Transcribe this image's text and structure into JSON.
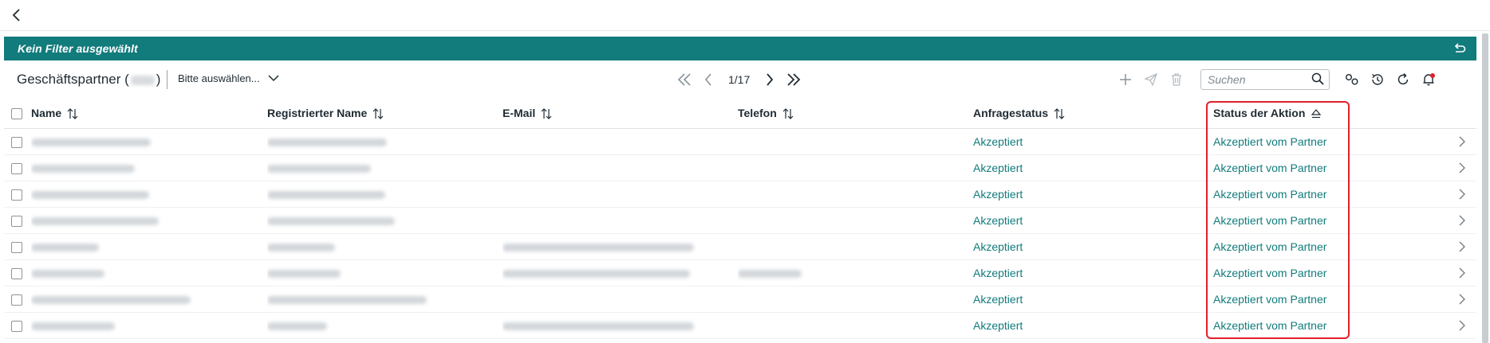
{
  "nav": {
    "back_icon": "chevron-left-icon"
  },
  "filter_bar": {
    "text": "Kein Filter ausgewählt",
    "reset_icon": "undo-icon",
    "color": "#127b7c"
  },
  "toolbar": {
    "title_prefix": "Geschäftspartner (",
    "title_suffix": ")",
    "dropdown_label": "Bitte auswählen...",
    "pagination": {
      "current": "1/17"
    },
    "search_placeholder": "Suchen",
    "icons": [
      "plus-icon",
      "send-icon",
      "trash-icon",
      "search-icon",
      "grouping-icon",
      "history-icon",
      "refresh-icon",
      "notification-bell-icon"
    ]
  },
  "table": {
    "columns": [
      "Name",
      "Registrierter Name",
      "E-Mail",
      "Telefon",
      "Anfragestatus",
      "Status der Aktion"
    ],
    "rows": [
      {
        "anfragestatus": "Akzeptiert",
        "status_aktion": "Akzeptiert vom Partner"
      },
      {
        "anfragestatus": "Akzeptiert",
        "status_aktion": "Akzeptiert vom Partner"
      },
      {
        "anfragestatus": "Akzeptiert",
        "status_aktion": "Akzeptiert vom Partner"
      },
      {
        "anfragestatus": "Akzeptiert",
        "status_aktion": "Akzeptiert vom Partner"
      },
      {
        "anfragestatus": "Akzeptiert",
        "status_aktion": "Akzeptiert vom Partner"
      },
      {
        "anfragestatus": "Akzeptiert",
        "status_aktion": "Akzeptiert vom Partner"
      },
      {
        "anfragestatus": "Akzeptiert",
        "status_aktion": "Akzeptiert vom Partner"
      },
      {
        "anfragestatus": "Akzeptiert",
        "status_aktion": "Akzeptiert vom Partner"
      }
    ]
  },
  "colors": {
    "accent": "#127b7c",
    "highlight": "#e0202a"
  }
}
